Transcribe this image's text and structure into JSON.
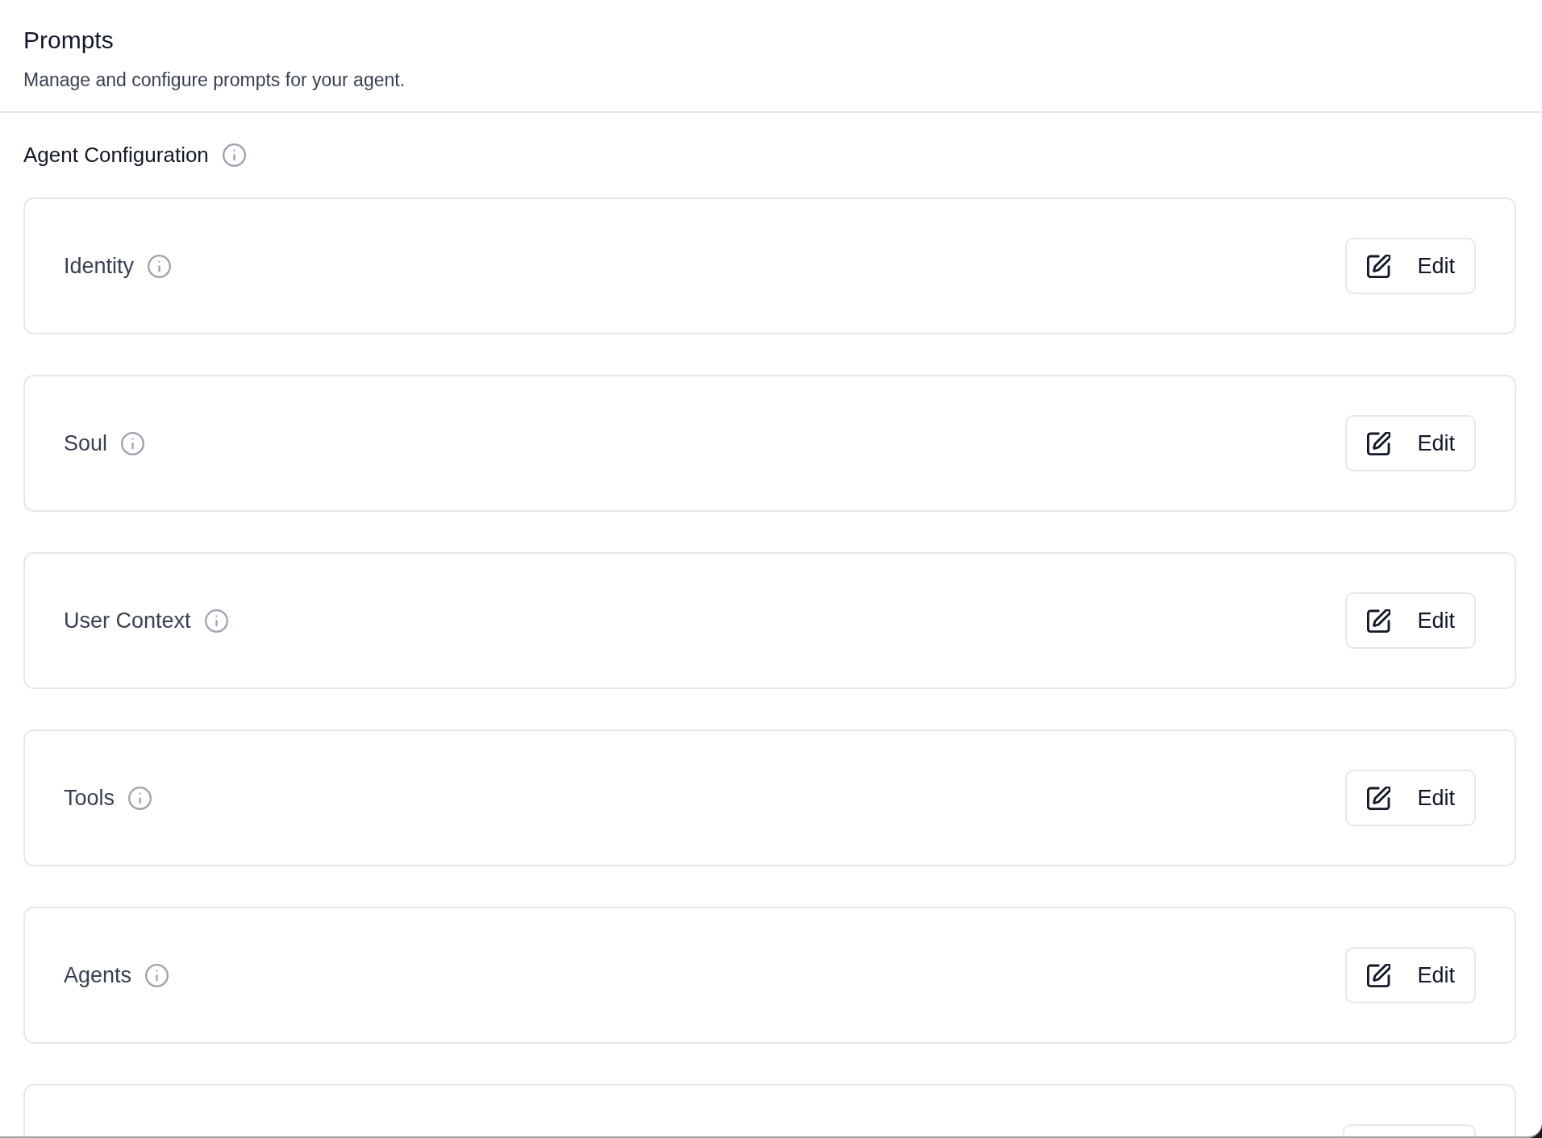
{
  "header": {
    "title": "Prompts",
    "subtitle": "Manage and configure prompts for your agent."
  },
  "section": {
    "title": "Agent Configuration"
  },
  "cards": [
    {
      "kind": "row",
      "label": "Identity",
      "button": "Edit"
    },
    {
      "kind": "row",
      "label": "Soul",
      "button": "Edit"
    },
    {
      "kind": "row",
      "label": "User Context",
      "button": "Edit"
    },
    {
      "kind": "row",
      "label": "Tools",
      "button": "Edit"
    },
    {
      "kind": "row",
      "label": "Agents",
      "button": "Edit"
    },
    {
      "kind": "cut_off"
    }
  ]
}
